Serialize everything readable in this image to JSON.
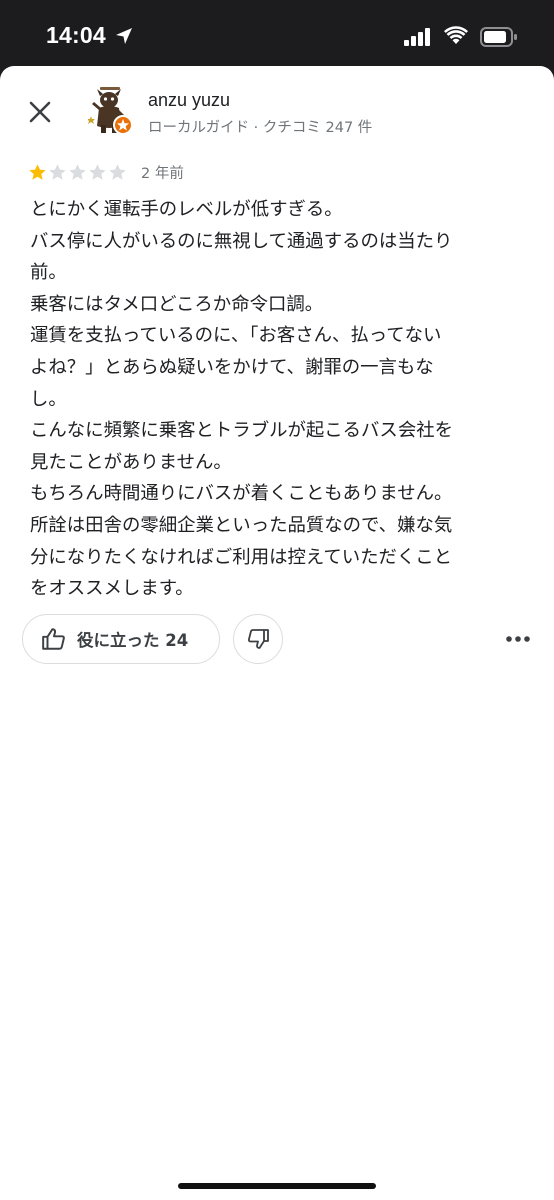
{
  "status_bar": {
    "time": "14:04"
  },
  "reviewer": {
    "name": "anzu yuzu",
    "meta": "ローカルガイド · クチコミ 247 件",
    "avatar_icon": "mascot-avatar-icon"
  },
  "review": {
    "rating": 1,
    "max_rating": 5,
    "date": "2 年前",
    "text": "とにかく運転手のレベルが低すぎる。\nバス停に人がいるのに無視して通過するのは当たり\n前。\n乗客にはタメ口どころか命令口調。\n運賃を支払っているのに、「お客さん、払ってない\nよね？」とあらぬ疑いをかけて、謝罪の一言もな\nし。\nこんなに頻繁に乗客とトラブルが起こるバス会社を\n見たことがありません。\nもちろん時間通りにバスが着くこともありません。\n所詮は田舎の零細企業といった品質なので、嫌な気\n分になりたくなければご利用は控えていただくこと\nをオススメします。"
  },
  "actions": {
    "helpful_label": "役に立った 24"
  },
  "colors": {
    "star_filled": "#fbbc04",
    "star_empty": "#dadce0",
    "badge": "#e8710a"
  }
}
